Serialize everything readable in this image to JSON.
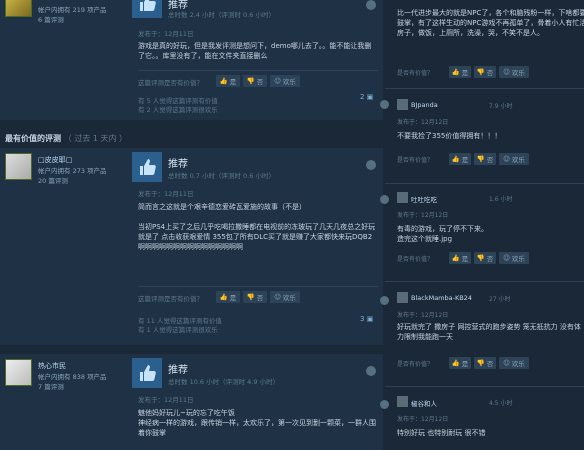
{
  "labels": {
    "recommended": "推荐",
    "helpful_q": "这篇评测是否有价值？",
    "yes": "是",
    "no": "否",
    "funny": "欢乐",
    "posted": "发布于：12月11日"
  },
  "top_review": {
    "user_stat": "帐户内拥有 219 项产品",
    "user_reviews": "6 篇评测",
    "hours": "总时数 2.4 小时（评测时 0.6 小时）",
    "body": "游戏是真的好玩，但是我发评测是想问下，demo哪儿去了。。能不能让我删了它。。库里没有了，能在文件夹直接删么",
    "helpful_count": "有 5 人觉得这篇评测有价值",
    "funny_count": "有 2 人觉得这篇评测很欢乐",
    "comments": "2"
  },
  "section": {
    "title": "最有价值的评测",
    "sub": "（ 过去 1 天内 ）"
  },
  "review1": {
    "name": "□皮皮耶□",
    "user_stat": "帐户内拥有 273 项产品",
    "user_reviews": "20 篇评测",
    "hours": "总时数 0.7 小时（评测时 0.6 小时）",
    "body": "简而言之这就是个艰辛德恋爱砖瓦爱施的故事（不是）\n\n当初PS4上买了之后几乎吃喝拉撒睡都在电视前的冻玻玩了几天几夜总之好玩就是了 点击收获艰爱情 355包了所有DLC买了就是赚了大家都快来玩DQB2啊啊啊啊啊啊啊啊啊啊啊啊啊啊啊",
    "helpful_count": "有 11 人觉得这篇评测有价值",
    "funny_count": "有 1 人觉得这篇评测很欢乐",
    "comments": "3"
  },
  "review2": {
    "name": "热心市民",
    "user_stat": "帐户内拥有 838 项产品",
    "user_reviews": "7 篇评测",
    "hours": "总时数 10.6 小时（评测时 4.9 小时）",
    "body": "魅他妈好玩儿~玩的忘了吃午饭\n神经病一样的游戏，跟传销一样，太欢乐了，第一次见到劐一颗菜，一群人围着你鼓掌"
  },
  "right": {
    "top_text": "比一代进步最大的就是NPC了，各个和脑残粉一样，下啥都要鼓掌，有了这样生动的NPC游戏不再孤单了，骨着小人有忙活房子，做饭，上厕所，洗澡，哭，不笑不是人。",
    "help_q": "是否有价值？",
    "c1": {
      "name": "BJpanda",
      "time": "7.9 小时",
      "text": "不要我捡了355价值得拥有！！！"
    },
    "c2": {
      "name": "吐吐吃吃",
      "time": "1.6 小时",
      "text": "有毒的游戏，玩了停不下来。\n造完这个就睡.jpg"
    },
    "c3": {
      "name": "BlackMamba-KB24",
      "time": "27 小时",
      "text": "好玩就完了 撒房子 网控营式的跑步姿势 笼无抵抗力 没有体力限制我能跑一天"
    },
    "c4": {
      "name": "椒谷和人",
      "time": "4.5 小时",
      "text": "特别好玩 也特别耐玩 很不错"
    },
    "posted": "发布于：12月12日"
  }
}
